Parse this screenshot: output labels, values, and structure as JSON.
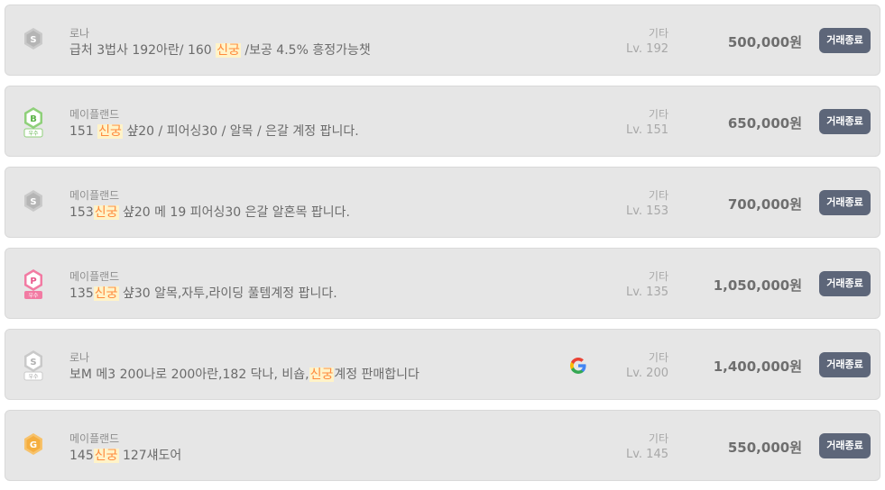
{
  "highlight_term": "신궁",
  "colors": {
    "row_bg": "#e6e6e6",
    "button_bg": "#5d6679",
    "highlight_text": "#ff8a3d",
    "highlight_bg": "#fff3c8"
  },
  "listings": [
    {
      "badge_icon": "silver-s-grade-icon",
      "server": "로나",
      "title_parts": [
        "급처 3법사 192아란/ 160 ",
        "신궁",
        " /보공 4.5% 흥정가능챗"
      ],
      "category": "기타",
      "level": "Lv. 192",
      "price": "500,000원",
      "status_button": "거래종료"
    },
    {
      "badge_icon": "green-b-grade-icon",
      "badge_label": "우수",
      "server": "메이플랜드",
      "title_parts": [
        "151 ",
        "신궁",
        " 샾20 / 피어싱30 / 알목 / 은갈 계정 팝니다."
      ],
      "category": "기타",
      "level": "Lv. 151",
      "price": "650,000원",
      "status_button": "거래종료"
    },
    {
      "badge_icon": "silver-s-grade-icon",
      "server": "메이플랜드",
      "title_parts": [
        "153",
        "신궁",
        " 샾20 메 19 피어싱30 은갈 알혼목 팝니다."
      ],
      "category": "기타",
      "level": "Lv. 153",
      "price": "700,000원",
      "status_button": "거래종료"
    },
    {
      "badge_icon": "pink-p-grade-icon",
      "badge_label": "우수",
      "server": "메이플랜드",
      "title_parts": [
        "135",
        "신궁",
        " 샾30 알목,자투,라이딩 풀템계정 팝니다."
      ],
      "category": "기타",
      "level": "Lv. 135",
      "price": "1,050,000원",
      "status_button": "거래종료"
    },
    {
      "badge_icon": "silver-s-grade-icon",
      "badge_label": "우수",
      "server": "로나",
      "title_parts": [
        "보M 메3 200나로 200아란,182 닥나, 비숍,",
        "신궁",
        "계정 판매합니다"
      ],
      "has_google_icon": true,
      "category": "기타",
      "level": "Lv. 200",
      "price": "1,400,000원",
      "status_button": "거래종료"
    },
    {
      "badge_icon": "gold-g-grade-icon",
      "server": "메이플랜드",
      "title_parts": [
        "145",
        "신궁",
        " 127섀도어"
      ],
      "category": "기타",
      "level": "Lv. 145",
      "price": "550,000원",
      "status_button": "거래종료"
    }
  ]
}
